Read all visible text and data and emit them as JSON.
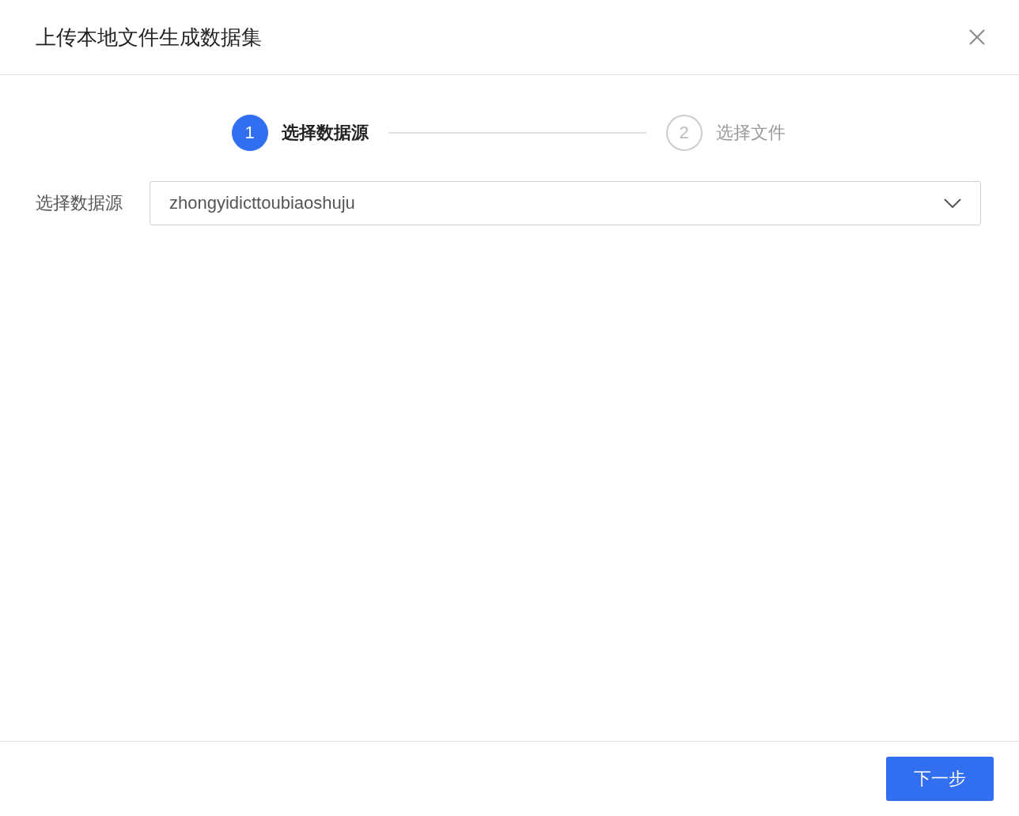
{
  "dialog": {
    "title": "上传本地文件生成数据集"
  },
  "steps": [
    {
      "number": "1",
      "label": "选择数据源",
      "selected": true
    },
    {
      "number": "2",
      "label": "选择文件",
      "selected": false
    }
  ],
  "field": {
    "label": "选择数据源",
    "value": "zhongyidicttoubiaoshuju"
  },
  "footer": {
    "button": "下一步"
  }
}
